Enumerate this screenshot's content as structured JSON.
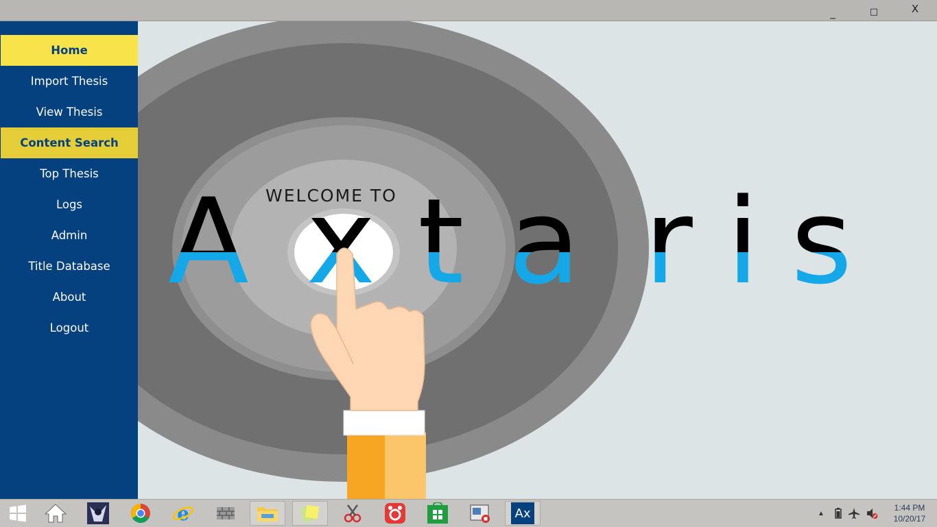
{
  "window": {
    "controls": {
      "minimize": "_",
      "maximize": "□",
      "close": "X"
    }
  },
  "sidebar": {
    "items": [
      {
        "label": "Home",
        "state": "active"
      },
      {
        "label": "Import Thesis",
        "state": "normal"
      },
      {
        "label": "View Thesis",
        "state": "normal"
      },
      {
        "label": "Content Search",
        "state": "hover"
      },
      {
        "label": "Top Thesis",
        "state": "normal"
      },
      {
        "label": "Logs",
        "state": "normal"
      },
      {
        "label": "Admin",
        "state": "normal"
      },
      {
        "label": "Title Database",
        "state": "normal"
      },
      {
        "label": "About",
        "state": "normal"
      },
      {
        "label": "Logout",
        "state": "normal"
      }
    ]
  },
  "hero": {
    "welcome": "WELCOME TO",
    "logo_letters": [
      "A",
      "x",
      "t",
      "a",
      "r",
      "i",
      "s"
    ]
  },
  "colors": {
    "sidebar_bg": "#06417f",
    "active_bg": "#f9e34b",
    "hover_bg": "#e5cd38",
    "logo_blue": "#14a8e8",
    "logo_black": "#000000",
    "content_bg": "#dde4e6"
  },
  "taskbar": {
    "apps": [
      {
        "icon": "windows-start-icon"
      },
      {
        "icon": "home-icon"
      },
      {
        "icon": "anime-avatar-icon"
      },
      {
        "icon": "chrome-icon"
      },
      {
        "icon": "internet-explorer-icon"
      },
      {
        "icon": "firewall-icon"
      },
      {
        "icon": "file-explorer-icon"
      },
      {
        "icon": "sticky-notes-icon"
      },
      {
        "icon": "snipping-tool-icon"
      },
      {
        "icon": "screen-recorder-icon"
      },
      {
        "icon": "windows-store-icon"
      },
      {
        "icon": "media-player-icon"
      },
      {
        "icon": "axtaris-app-icon",
        "label": "Ax"
      }
    ],
    "clock": {
      "time": "1:44 PM",
      "date": "10/20/17"
    }
  }
}
